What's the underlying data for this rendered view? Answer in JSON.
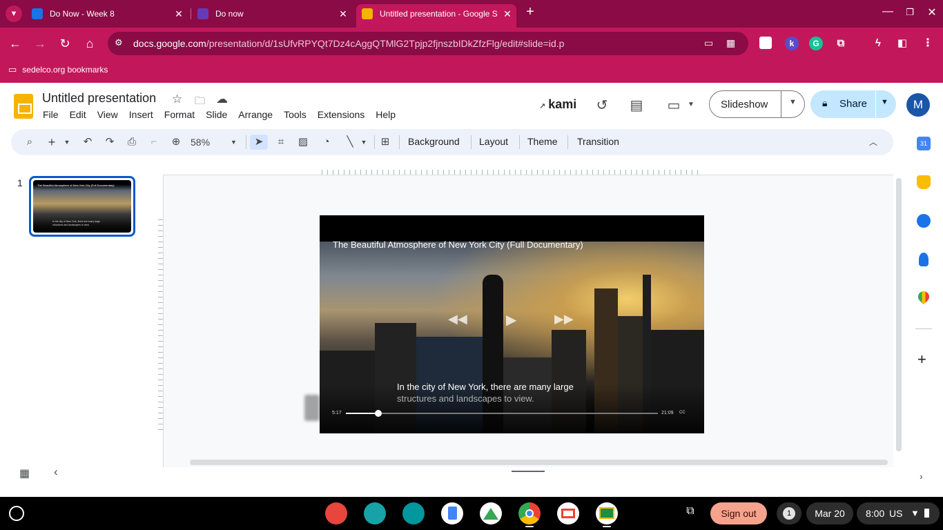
{
  "browser": {
    "tabs": [
      {
        "title": "Do Now - Week 8",
        "favicon_color": "#1a73e8"
      },
      {
        "title": "Do now",
        "favicon_color": "#673ab7"
      },
      {
        "title": "Untitled presentation - Google S",
        "favicon_color": "#f4b400",
        "active": true
      }
    ],
    "new_tab_icon": "plus-icon",
    "url_host": "docs.google.com",
    "url_path": "/presentation/d/1sUfvRPYQt7Dz4cAggQTMlG2Tpjp2fjnszbIDkZfzFlg/edit#slide=id.p",
    "bookmark_folder": "sedelco.org bookmarks",
    "extension_k_label": "k"
  },
  "slides_app": {
    "doc_title": "Untitled presentation",
    "menus": [
      "File",
      "Edit",
      "View",
      "Insert",
      "Format",
      "Slide",
      "Arrange",
      "Tools",
      "Extensions",
      "Help"
    ],
    "kami_label": "kami",
    "slideshow_label": "Slideshow",
    "share_label": "Share",
    "avatar_initial": "M",
    "toolbar": {
      "zoom": "58%",
      "background_label": "Background",
      "layout_label": "Layout",
      "theme_label": "Theme",
      "transition_label": "Transition"
    },
    "filmstrip": {
      "slide_number": "1"
    }
  },
  "slide": {
    "video_title": "The Beautiful Atmosphere of New York City (Full Documentary)",
    "caption_line1": "In the city of New York, there are many large",
    "caption_line2": "structures and landscapes to view.",
    "current_time": "5:17",
    "duration": "21:09",
    "progress_fraction": 0.104,
    "cc_label": "CC"
  },
  "shelf": {
    "sign_out_label": "Sign out",
    "notification_count": "1",
    "date": "Mar 20",
    "time": "8:00",
    "locale": "US"
  },
  "colors": {
    "chrome_dark": "#8a0b45",
    "chrome_accent": "#c2185b",
    "share_bg": "#c2e7ff",
    "selection_blue": "#0b57d0"
  }
}
